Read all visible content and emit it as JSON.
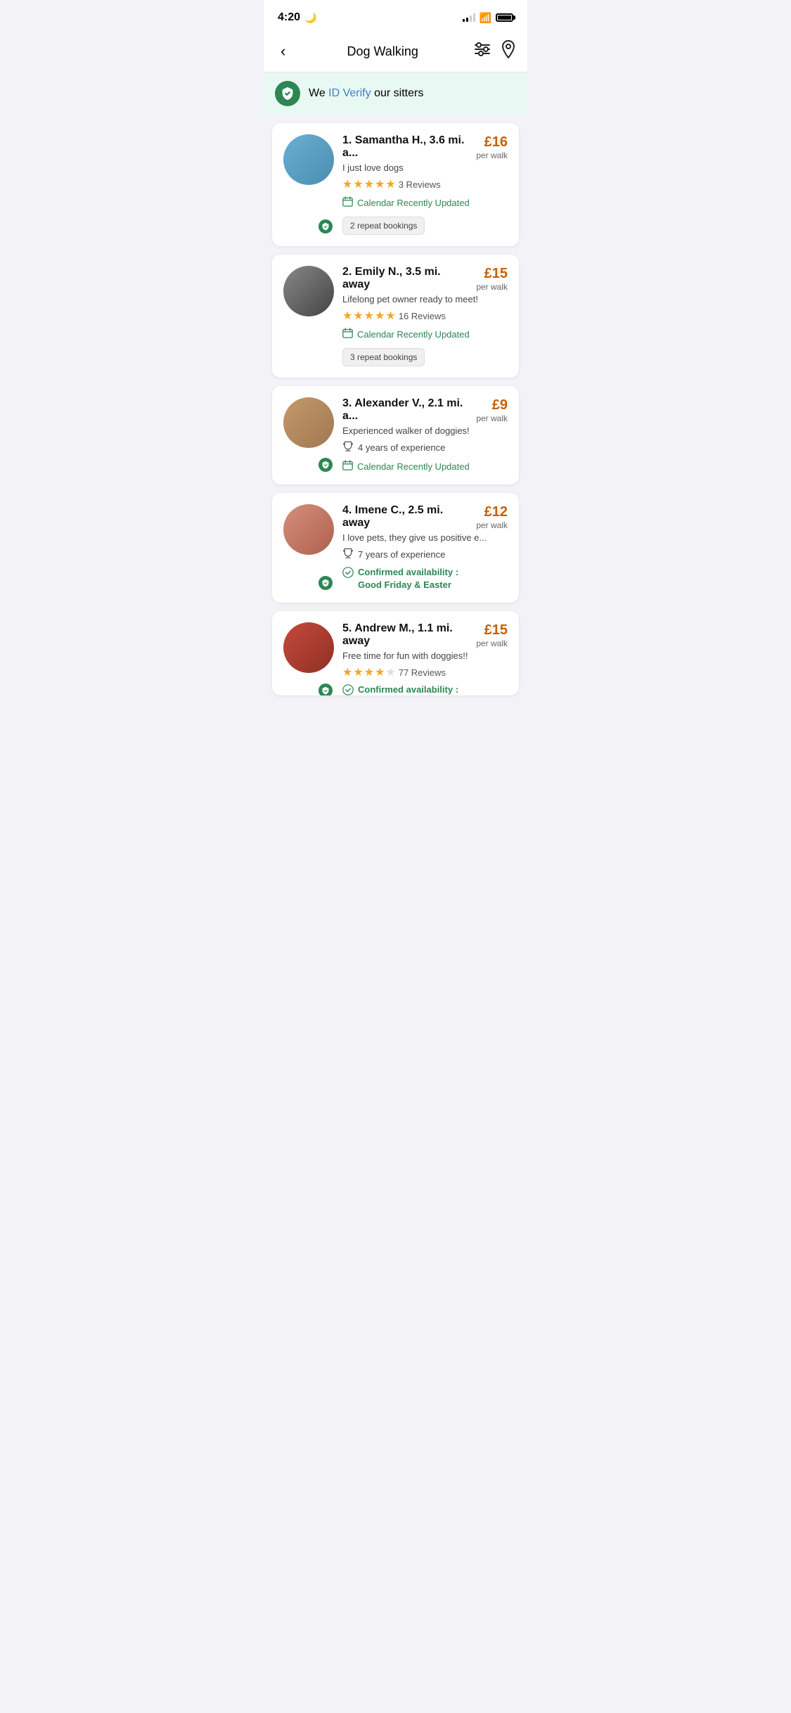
{
  "statusBar": {
    "time": "4:20",
    "moonIcon": "🌙"
  },
  "header": {
    "title": "Dog Walking",
    "backLabel": "‹",
    "filterLabel": "filter-icon",
    "locationLabel": "location-icon"
  },
  "banner": {
    "text_pre": "We ",
    "text_link": "ID Verify",
    "text_post": " our sitters"
  },
  "sitters": [
    {
      "rank": "1",
      "name": "Samantha H.",
      "distance": "3.6 mi. a...",
      "tagline": "I just love dogs",
      "price": "£16",
      "priceUnit": "per walk",
      "stars": 5,
      "reviews": "3 Reviews",
      "calendarUpdated": true,
      "calendarText": "Calendar Recently Updated",
      "repeatBookings": "2 repeat bookings",
      "hasExperience": false,
      "experienceYears": "",
      "confirmedAvailability": false,
      "confirmedText": "",
      "hasBadge": true,
      "avatarColor": "blue"
    },
    {
      "rank": "2",
      "name": "Emily N.",
      "distance": "3.5 mi. away",
      "tagline": "Lifelong pet owner ready to meet!",
      "price": "£15",
      "priceUnit": "per walk",
      "stars": 5,
      "reviews": "16 Reviews",
      "calendarUpdated": true,
      "calendarText": "Calendar Recently Updated",
      "repeatBookings": "3 repeat bookings",
      "hasExperience": false,
      "experienceYears": "",
      "confirmedAvailability": false,
      "confirmedText": "",
      "hasBadge": false,
      "avatarColor": "dark"
    },
    {
      "rank": "3",
      "name": "Alexander V.",
      "distance": "2.1 mi. a...",
      "tagline": "Experienced walker of doggies!",
      "price": "£9",
      "priceUnit": "per walk",
      "stars": 0,
      "reviews": "",
      "calendarUpdated": true,
      "calendarText": "Calendar Recently Updated",
      "repeatBookings": "",
      "hasExperience": true,
      "experienceYears": "4 years of experience",
      "confirmedAvailability": false,
      "confirmedText": "",
      "hasBadge": true,
      "avatarColor": "tan"
    },
    {
      "rank": "4",
      "name": "Imene C.",
      "distance": "2.5 mi. away",
      "tagline": "I love pets, they give us positive e...",
      "price": "£12",
      "priceUnit": "per walk",
      "stars": 0,
      "reviews": "",
      "calendarUpdated": false,
      "calendarText": "",
      "repeatBookings": "",
      "hasExperience": true,
      "experienceYears": "7 years of experience",
      "confirmedAvailability": true,
      "confirmedText": "Confirmed availability :\nGood Friday & Easter",
      "hasBadge": true,
      "avatarColor": "warm"
    },
    {
      "rank": "5",
      "name": "Andrew M.",
      "distance": "1.1 mi. away",
      "tagline": "Free time for fun with doggies!!",
      "price": "£15",
      "priceUnit": "per walk",
      "stars": 4,
      "reviews": "77 Reviews",
      "calendarUpdated": false,
      "calendarText": "",
      "repeatBookings": "",
      "hasExperience": false,
      "experienceYears": "",
      "confirmedAvailability": true,
      "confirmedText": "Confirmed availability :",
      "hasBadge": true,
      "avatarColor": "red"
    }
  ],
  "icons": {
    "back": "‹",
    "calendar": "📅",
    "trophy": "🏆",
    "checkCircle": "✅",
    "shield": "🛡"
  }
}
